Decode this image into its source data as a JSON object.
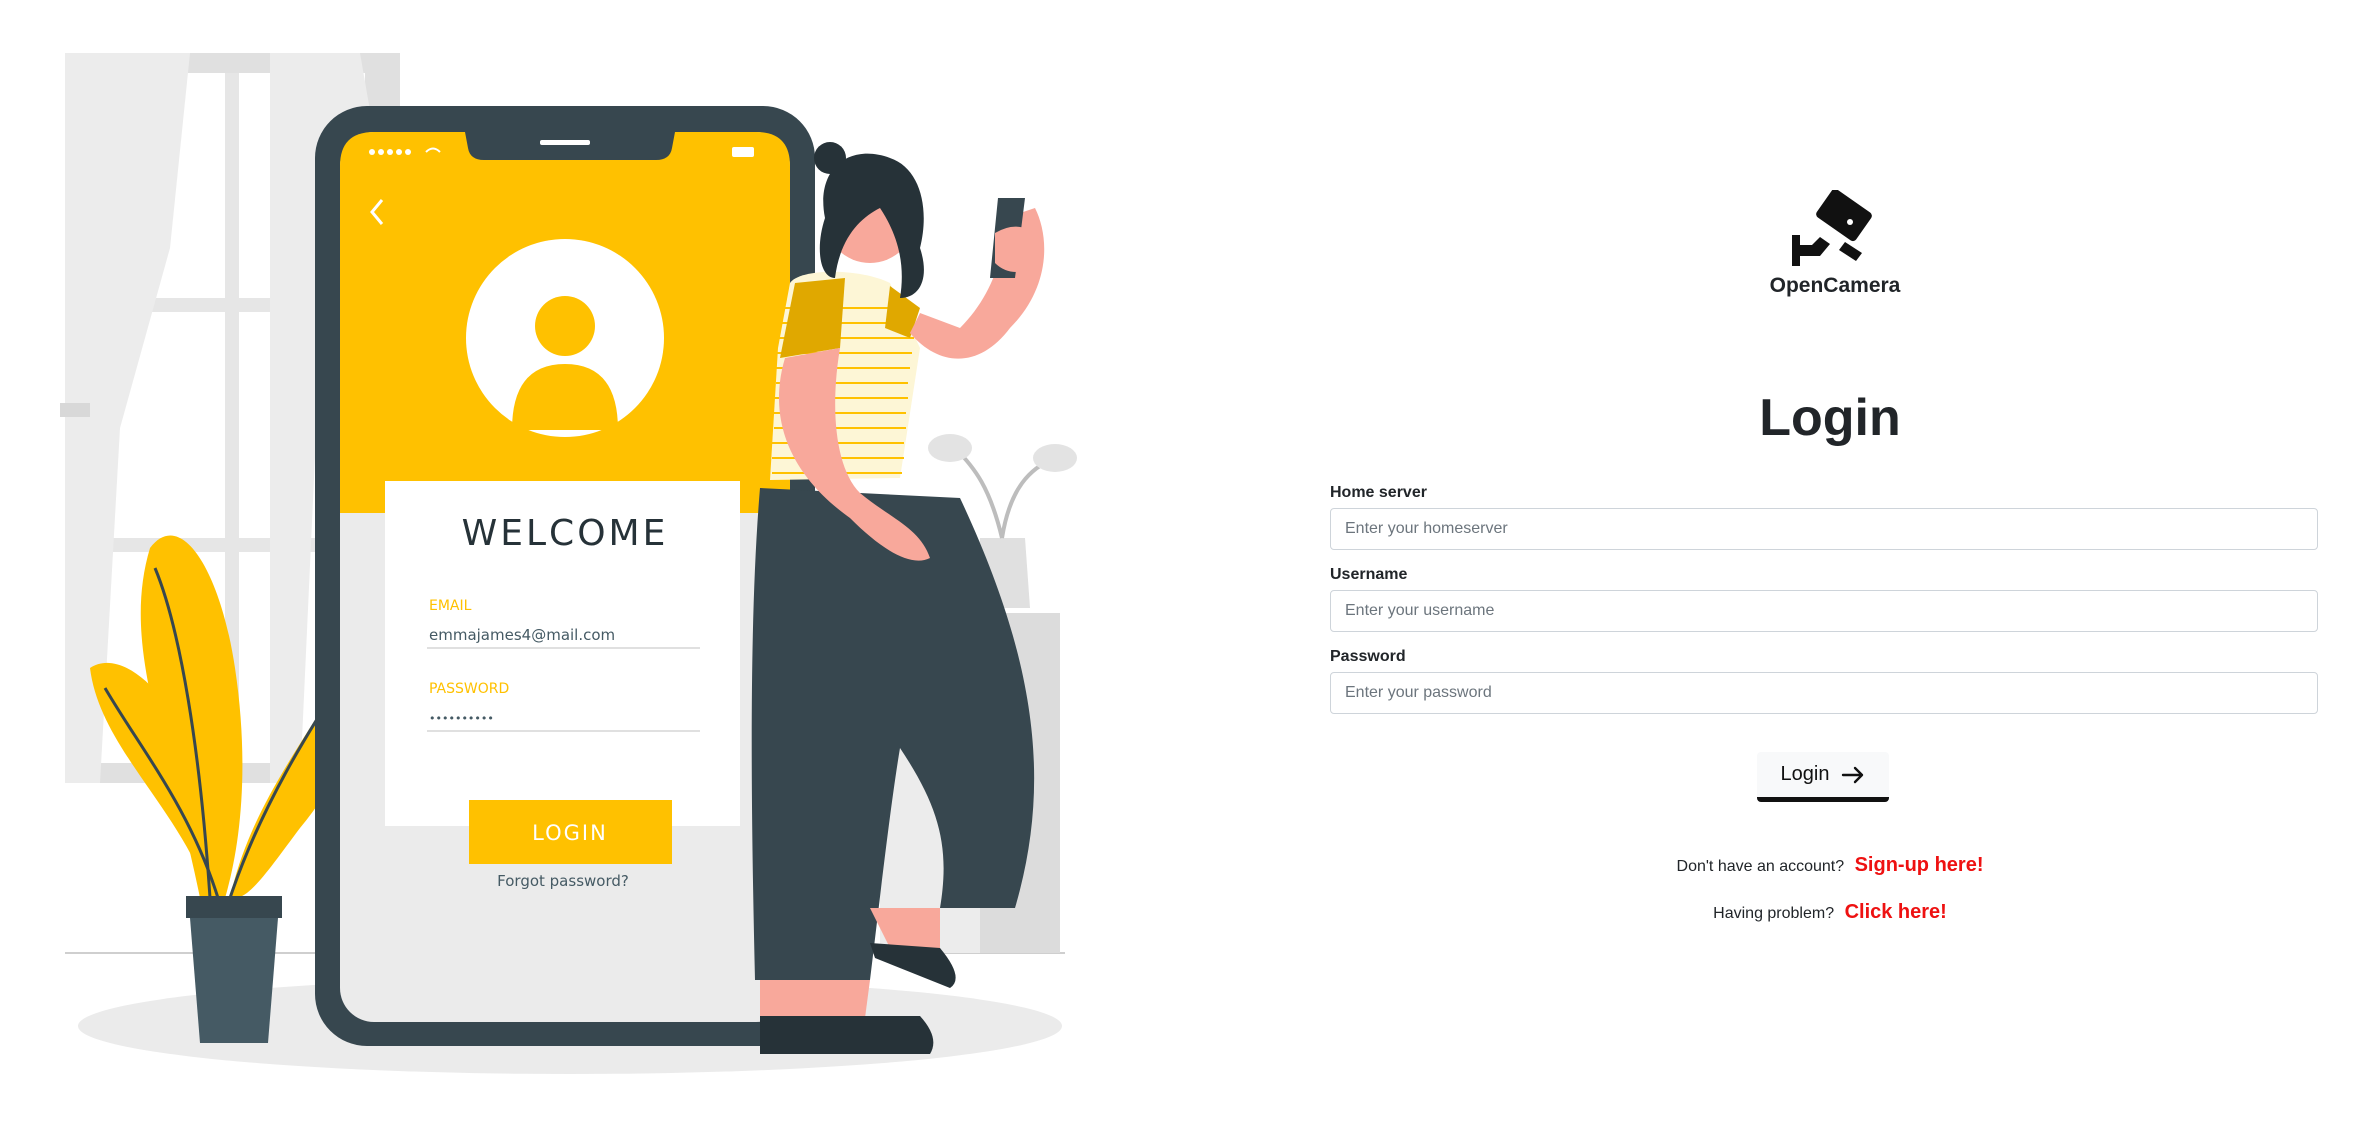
{
  "illustration": {
    "welcome_title": "WELCOME",
    "email_label": "EMAIL",
    "email_value": "emmajames4@mail.com",
    "password_label": "PASSWORD",
    "password_value": "••••••••••",
    "login_button": "LOGIN",
    "forgot_password": "Forgot password?"
  },
  "brand": {
    "name": "OpenCamera",
    "icon": "security-camera-icon"
  },
  "login": {
    "title": "Login",
    "home_server_label": "Home server",
    "home_server_placeholder": "Enter your homeserver",
    "username_label": "Username",
    "username_placeholder": "Enter your username",
    "password_label": "Password",
    "password_placeholder": "Enter your password",
    "submit_label": "Login",
    "submit_icon": "arrow-right-icon"
  },
  "signup": {
    "prompt": "Don't have an account?",
    "link": "Sign-up here!"
  },
  "help": {
    "prompt": "Having problem?",
    "link": "Click here!"
  },
  "colors": {
    "accent_yellow": "#FFC100",
    "dark_slate": "#37474F",
    "link_red": "#EE1111"
  }
}
